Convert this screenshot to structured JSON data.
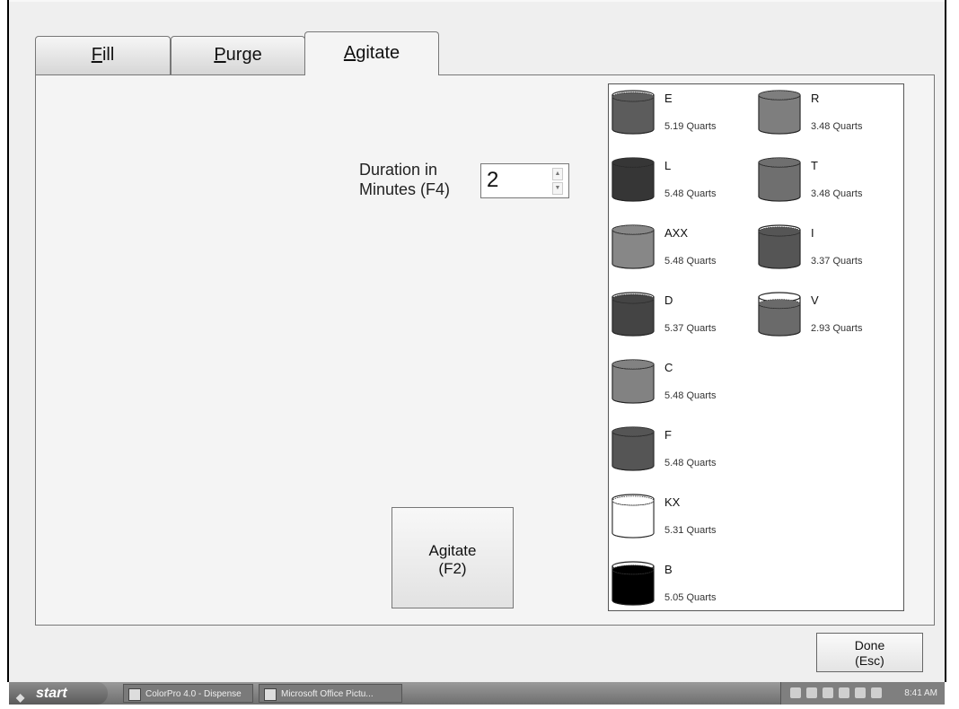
{
  "tabs": [
    {
      "label": "Fill",
      "mnemonic": "F",
      "rest": "ill"
    },
    {
      "label": "Purge",
      "mnemonic": "P",
      "rest": "urge"
    },
    {
      "label": "Agitate",
      "mnemonic": "A",
      "rest": "gitate",
      "active": true
    }
  ],
  "duration": {
    "label_line1": "Duration in",
    "label_line2": "Minutes (F4)",
    "value": "2"
  },
  "agitate_button": {
    "line1": "Agitate",
    "line2": "(F2)"
  },
  "done_button": {
    "line1": "Done",
    "line2": "(Esc)"
  },
  "canisters": [
    {
      "name": "E",
      "qty": "5.19 Quarts",
      "color": "#5c5c5c",
      "fill": 0.95
    },
    {
      "name": "R",
      "qty": "3.48 Quarts",
      "color": "#7e7e7e",
      "fill": 1.0
    },
    {
      "name": "L",
      "qty": "5.48 Quarts",
      "color": "#363636",
      "fill": 1.0
    },
    {
      "name": "T",
      "qty": "3.48 Quarts",
      "color": "#6f6f6f",
      "fill": 1.0
    },
    {
      "name": "AXX",
      "qty": "5.48 Quarts",
      "color": "#878787",
      "fill": 1.0
    },
    {
      "name": "I",
      "qty": "3.37 Quarts",
      "color": "#555555",
      "fill": 0.95
    },
    {
      "name": "D",
      "qty": "5.37 Quarts",
      "color": "#444444",
      "fill": 0.95
    },
    {
      "name": "V",
      "qty": "2.93 Quarts",
      "color": "#6a6a6a",
      "fill": 0.8
    },
    {
      "name": "C",
      "qty": "5.48 Quarts",
      "color": "#828282",
      "fill": 1.0
    },
    {
      "name": "F",
      "qty": "5.48 Quarts",
      "color": "#555555",
      "fill": 1.0
    },
    {
      "name": "KX",
      "qty": "5.31 Quarts",
      "color": "#ffffff",
      "fill": 0.95
    },
    {
      "name": "B",
      "qty": "5.05 Quarts",
      "color": "#000000",
      "fill": 0.9
    }
  ],
  "taskbar": {
    "start_label": "start",
    "tasks": [
      "ColorPro 4.0 - Dispense",
      "Microsoft Office Pictu..."
    ],
    "clock": "8:41 AM"
  }
}
